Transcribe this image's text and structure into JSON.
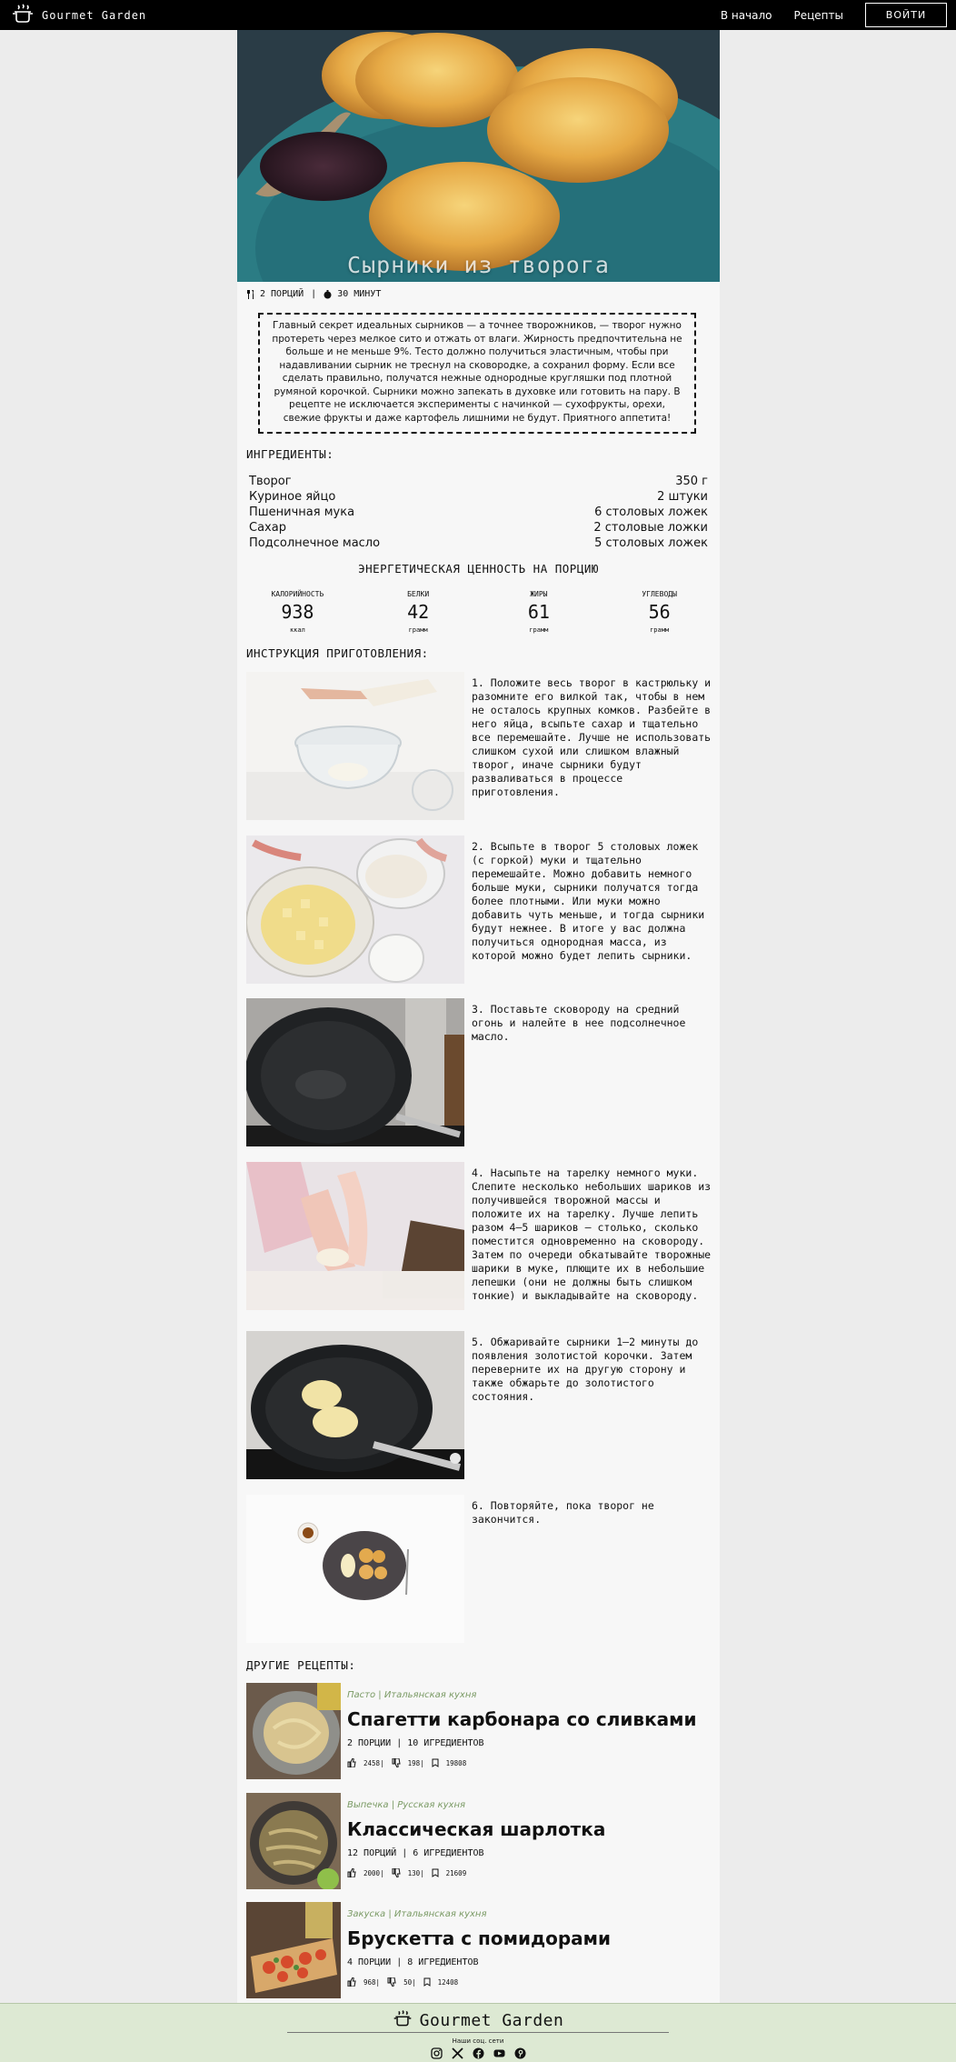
{
  "header": {
    "brand": "Gourmet Garden",
    "nav_home": "В начало",
    "nav_recipes": "Рецепты",
    "login": "ВОЙТИ"
  },
  "recipe": {
    "title": "Сырники из творога",
    "servings": "2 ПОРЦИЙ",
    "time": "30 МИНУТ",
    "description": "Главный секрет идеальных сырников — а точнее творожников, — творог нужно протереть через мелкое сито и отжать от влаги. Жирность предпочтительна не больше и не меньше 9%. Тесто должно получиться эластичным, чтобы при надавливании сырник не треснул на сковородке, а сохранил форму. Если все сделать правильно, получатся нежные однородные кругляшки под плотной румяной корочкой. Сырники можно запекать в духовке или готовить на пару. В рецепте не исключается эксперименты с начинкой — сухофрукты, орехи, свежие фрукты и даже картофель лишними не будут. Приятного аппетита!"
  },
  "ingredients": {
    "title": "ИНГРЕДИЕНТЫ:",
    "items": [
      {
        "name": "Творог",
        "amount": "350 г"
      },
      {
        "name": "Куриное яйцо",
        "amount": "2 штуки"
      },
      {
        "name": "Пшеничная мука",
        "amount": "6 столовых ложек"
      },
      {
        "name": "Сахар",
        "amount": "2 столовые ложки"
      },
      {
        "name": "Подсолнечное масло",
        "amount": "5 столовых ложек"
      }
    ]
  },
  "energy": {
    "title": "ЭНЕРГЕТИЧЕСКАЯ ЦЕННОСТЬ НА ПОРЦИЮ",
    "items": [
      {
        "label": "КАЛОРИЙНОСТЬ",
        "value": "938",
        "unit": "ккал"
      },
      {
        "label": "БЕЛКИ",
        "value": "42",
        "unit": "грамм"
      },
      {
        "label": "ЖИРЫ",
        "value": "61",
        "unit": "грамм"
      },
      {
        "label": "УГЛЕВОДЫ",
        "value": "56",
        "unit": "грамм"
      }
    ]
  },
  "instructions": {
    "title": "ИНСТРУКЦИЯ ПРИГОТОВЛЕНИЯ:",
    "steps": [
      {
        "text": "1. Положите весь творог в кастрюльку и разомните его вилкой так, чтобы в нем не осталось крупных комков. Разбейте в него яйца, всыпьте сахар и тщательно все перемешайте. Лучше не использовать слишком сухой или слишком влажный творог, иначе сырники будут разваливаться в процессе приготовления."
      },
      {
        "text": "2. Всыпьте в творог 5 столовых ложек (с горкой) муки и тщательно перемешайте. Можно добавить немного больше муки, сырники получатся тогда более плотными. Или муки можно добавить чуть меньше, и тогда сырники будут нежнее. В итоге у вас должна получиться однородная масса, из которой можно будет лепить сырники."
      },
      {
        "text": "3. Поставьте сковороду на средний огонь и налейте в нее подсолнечное масло."
      },
      {
        "text": "4. Насыпьте на тарелку немного муки. Слепите несколько небольших шариков из получившейся творожной массы и положите их на тарелку. Лучше лепить разом 4–5 шариков — столько, сколько поместится одновременно на сковороду. Затем по очереди обкатывайте творожные шарики в муке, плющите их в небольшие лепешки (они не должны быть слишком тонкие) и выкладывайте на сковороду."
      },
      {
        "text": "5. Обжаривайте сырники 1–2 минуты до появления золотистой корочки. Затем переверните их на другую сторону и также обжарьте до золотистого состояния."
      },
      {
        "text": "6. Повторяйте, пока творог не закончится."
      }
    ]
  },
  "other_recipes": {
    "title": "ДРУГИЕ РЕЦЕПТЫ:",
    "items": [
      {
        "category": "Пасто",
        "cuisine": "Итальянская кухня",
        "title": "Спагетти карбонара со сливками",
        "servings": "2 ПОРЦИИ",
        "ingredients": "10 ИГРЕДИЕНТОВ",
        "likes": "2458",
        "dislikes": "198",
        "saves": "19808"
      },
      {
        "category": "Выпечка",
        "cuisine": "Русская кухня",
        "title": "Классическая шарлотка",
        "servings": "12 ПОРЦИЙ",
        "ingredients": "6 ИГРЕДИЕНТОВ",
        "likes": "2000",
        "dislikes": "130",
        "saves": "21609"
      },
      {
        "category": "Закуска",
        "cuisine": "Итальянская кухня",
        "title": "Брускетта с помидорами",
        "servings": "4 ПОРЦИИ",
        "ingredients": "8 ИГРЕДИЕНТОВ",
        "likes": "968",
        "dislikes": "50",
        "saves": "12408"
      }
    ]
  },
  "footer": {
    "brand": "Gourmet Garden",
    "social_label": "Наши соц. сети",
    "icons": [
      "instagram-icon",
      "x-icon",
      "facebook-icon",
      "youtube-icon",
      "pinterest-icon"
    ]
  },
  "colors": {
    "header_bg": "#000000",
    "page_bg": "#ececec",
    "content_bg": "#f7f7f7",
    "footer_bg": "#dde9d3",
    "category_green": "#7a9a64"
  }
}
